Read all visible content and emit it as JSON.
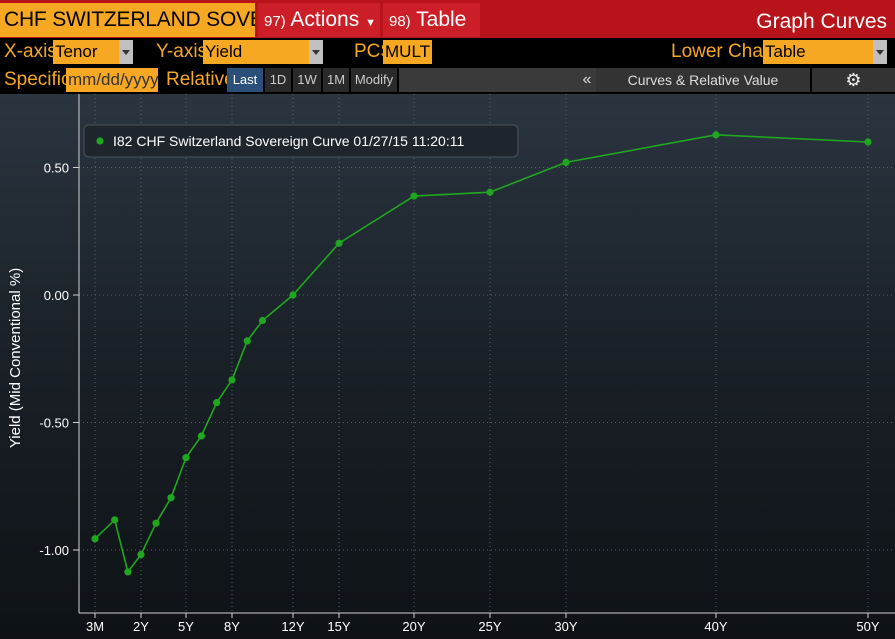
{
  "header": {
    "security_title": "CHF SWITZERLAND SOVEREIGN",
    "actions_num": "97)",
    "actions_label": "Actions",
    "table_num": "98)",
    "table_label": "Table",
    "function_title": "Graph Curves"
  },
  "controls": {
    "xaxis_label": "X-axis",
    "xaxis_value": "Tenor",
    "yaxis_label": "Y-axis",
    "yaxis_value": "Yield",
    "pcs_label": "PCS",
    "pcs_value": "MULT",
    "lower_chart_label": "Lower Chart",
    "lower_chart_value": "Table",
    "specific_label": "Specific",
    "specific_placeholder": "mm/dd/yyyy",
    "relative_label": "Relative",
    "periods": [
      "Last",
      "1D",
      "1W",
      "1M",
      "Modify"
    ],
    "collapse_glyph": "«",
    "curves_label": "Curves & Relative Value",
    "gear_glyph": "⚙"
  },
  "colors": {
    "series": "#1fa81f",
    "accent": "#f7a823",
    "header_red": "#b8121a"
  },
  "chart_data": {
    "type": "line",
    "ylabel": "Yield (Mid Conventional %)",
    "ylim": [
      -1.25,
      0.68
    ],
    "yticks": [
      0.5,
      0.0,
      -0.5,
      -1.0
    ],
    "ytick_labels": [
      "0.50",
      "0.00",
      "-0.50",
      "-1.00"
    ],
    "xtick_labels": [
      "3M",
      "2Y",
      "5Y",
      "8Y",
      "12Y",
      "15Y",
      "20Y",
      "25Y",
      "30Y",
      "40Y",
      "50Y"
    ],
    "xtick_years": [
      0.25,
      2,
      5,
      8,
      12,
      15,
      20,
      25,
      30,
      40,
      50
    ],
    "legend_position": "top-left",
    "series": [
      {
        "name": "I82 CHF Switzerland Sovereign Curve 01/27/15 11:20:11",
        "x": [
          0.25,
          1,
          1.5,
          2,
          3,
          4,
          5,
          6,
          7,
          8,
          9,
          10,
          12,
          15,
          20,
          25,
          30,
          40,
          50
        ],
        "values": [
          -0.956,
          -0.882,
          -1.086,
          -1.018,
          -0.895,
          -0.795,
          -0.638,
          -0.553,
          -0.422,
          -0.333,
          -0.18,
          -0.1,
          0.0,
          0.203,
          0.388,
          0.403,
          0.52,
          0.628,
          0.6
        ]
      }
    ]
  }
}
